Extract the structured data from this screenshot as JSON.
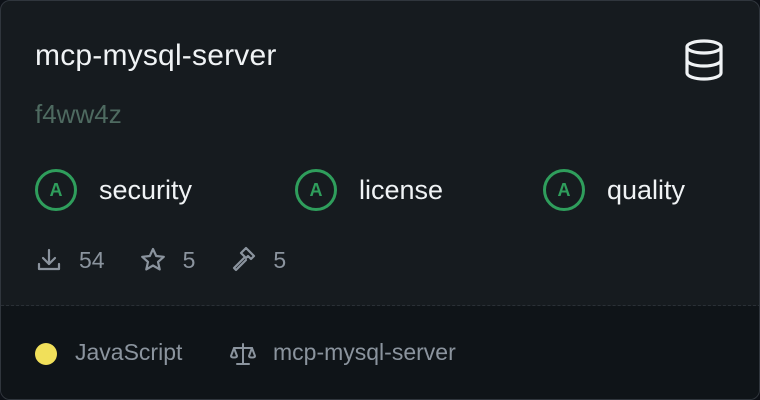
{
  "card": {
    "title": "mcp-mysql-server",
    "subtitle": "f4ww4z",
    "type_icon": "database-icon"
  },
  "grades": [
    {
      "grade": "A",
      "label": "security"
    },
    {
      "grade": "A",
      "label": "license"
    },
    {
      "grade": "A",
      "label": "quality"
    }
  ],
  "stats": {
    "downloads": "54",
    "stars": "5",
    "tools": "5"
  },
  "footer": {
    "language": "JavaScript",
    "language_color": "#f1e05a",
    "license_label": "mcp-mysql-server"
  },
  "colors": {
    "grade_green": "#2f9e5c",
    "muted_text": "#8b949e",
    "subtitle_text": "#4e6a60"
  }
}
